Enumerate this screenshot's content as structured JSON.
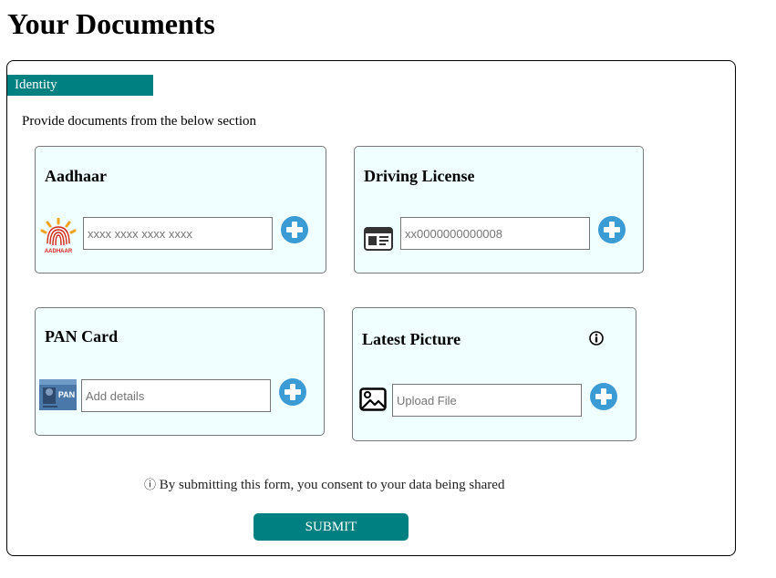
{
  "page": {
    "title": "Your Documents"
  },
  "section": {
    "tab_label": "Identity",
    "instructions": "Provide documents from the below section"
  },
  "cards": {
    "aadhaar": {
      "title": "Aadhaar",
      "placeholder": "xxxx xxxx xxxx xxxx",
      "icon": "aadhaar-logo-icon",
      "icon_text": "AADHAAR"
    },
    "driving_license": {
      "title": "Driving License",
      "placeholder": "xx0000000000008",
      "icon": "license-card-icon"
    },
    "pan": {
      "title": "PAN Card",
      "placeholder": "Add details",
      "icon": "pan-card-icon",
      "icon_text": "PAN"
    },
    "picture": {
      "title": "Latest Picture",
      "placeholder": "Upload File",
      "icon": "image-icon",
      "info_icon": "info-icon"
    }
  },
  "consent": {
    "glyph": "ⓘ",
    "text": "By submitting this form, you consent to your data being shared"
  },
  "submit": {
    "label": "SUBMIT"
  },
  "colors": {
    "accent": "#008080",
    "card_bg": "#f0ffff",
    "add_button": "#3a9bd5"
  }
}
